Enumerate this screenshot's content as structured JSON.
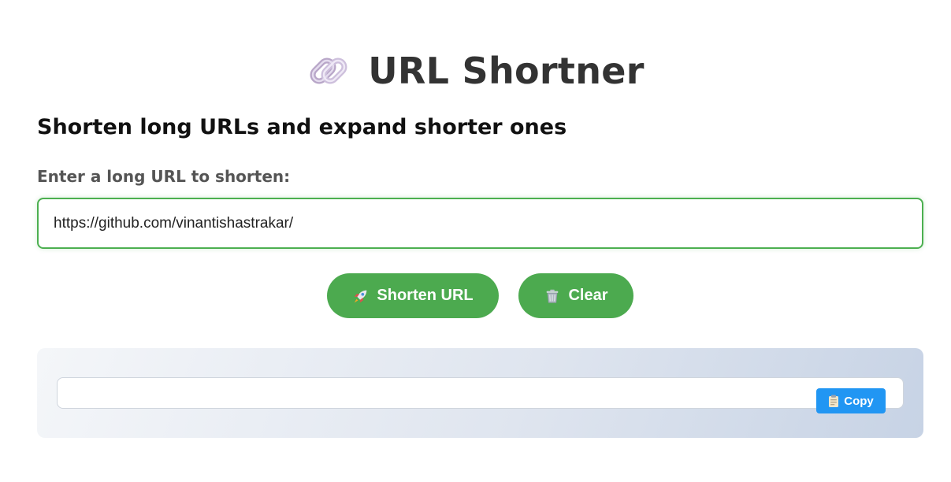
{
  "header": {
    "title": "URL Shortner",
    "icon": "link-icon"
  },
  "subtitle": "Shorten long URLs and expand shorter ones",
  "form": {
    "label": "Enter a long URL to shorten:",
    "input_value": "https://github.com/vinantishastrakar/",
    "shorten_label": "Shorten URL",
    "shorten_icon": "rocket-icon",
    "clear_label": "Clear",
    "clear_icon": "trash-icon"
  },
  "result": {
    "value": "",
    "copy_label": "Copy",
    "copy_icon": "clipboard-icon"
  },
  "colors": {
    "accent_green": "#4caa4f",
    "copy_blue": "#2196f3",
    "title_text": "#333333"
  }
}
